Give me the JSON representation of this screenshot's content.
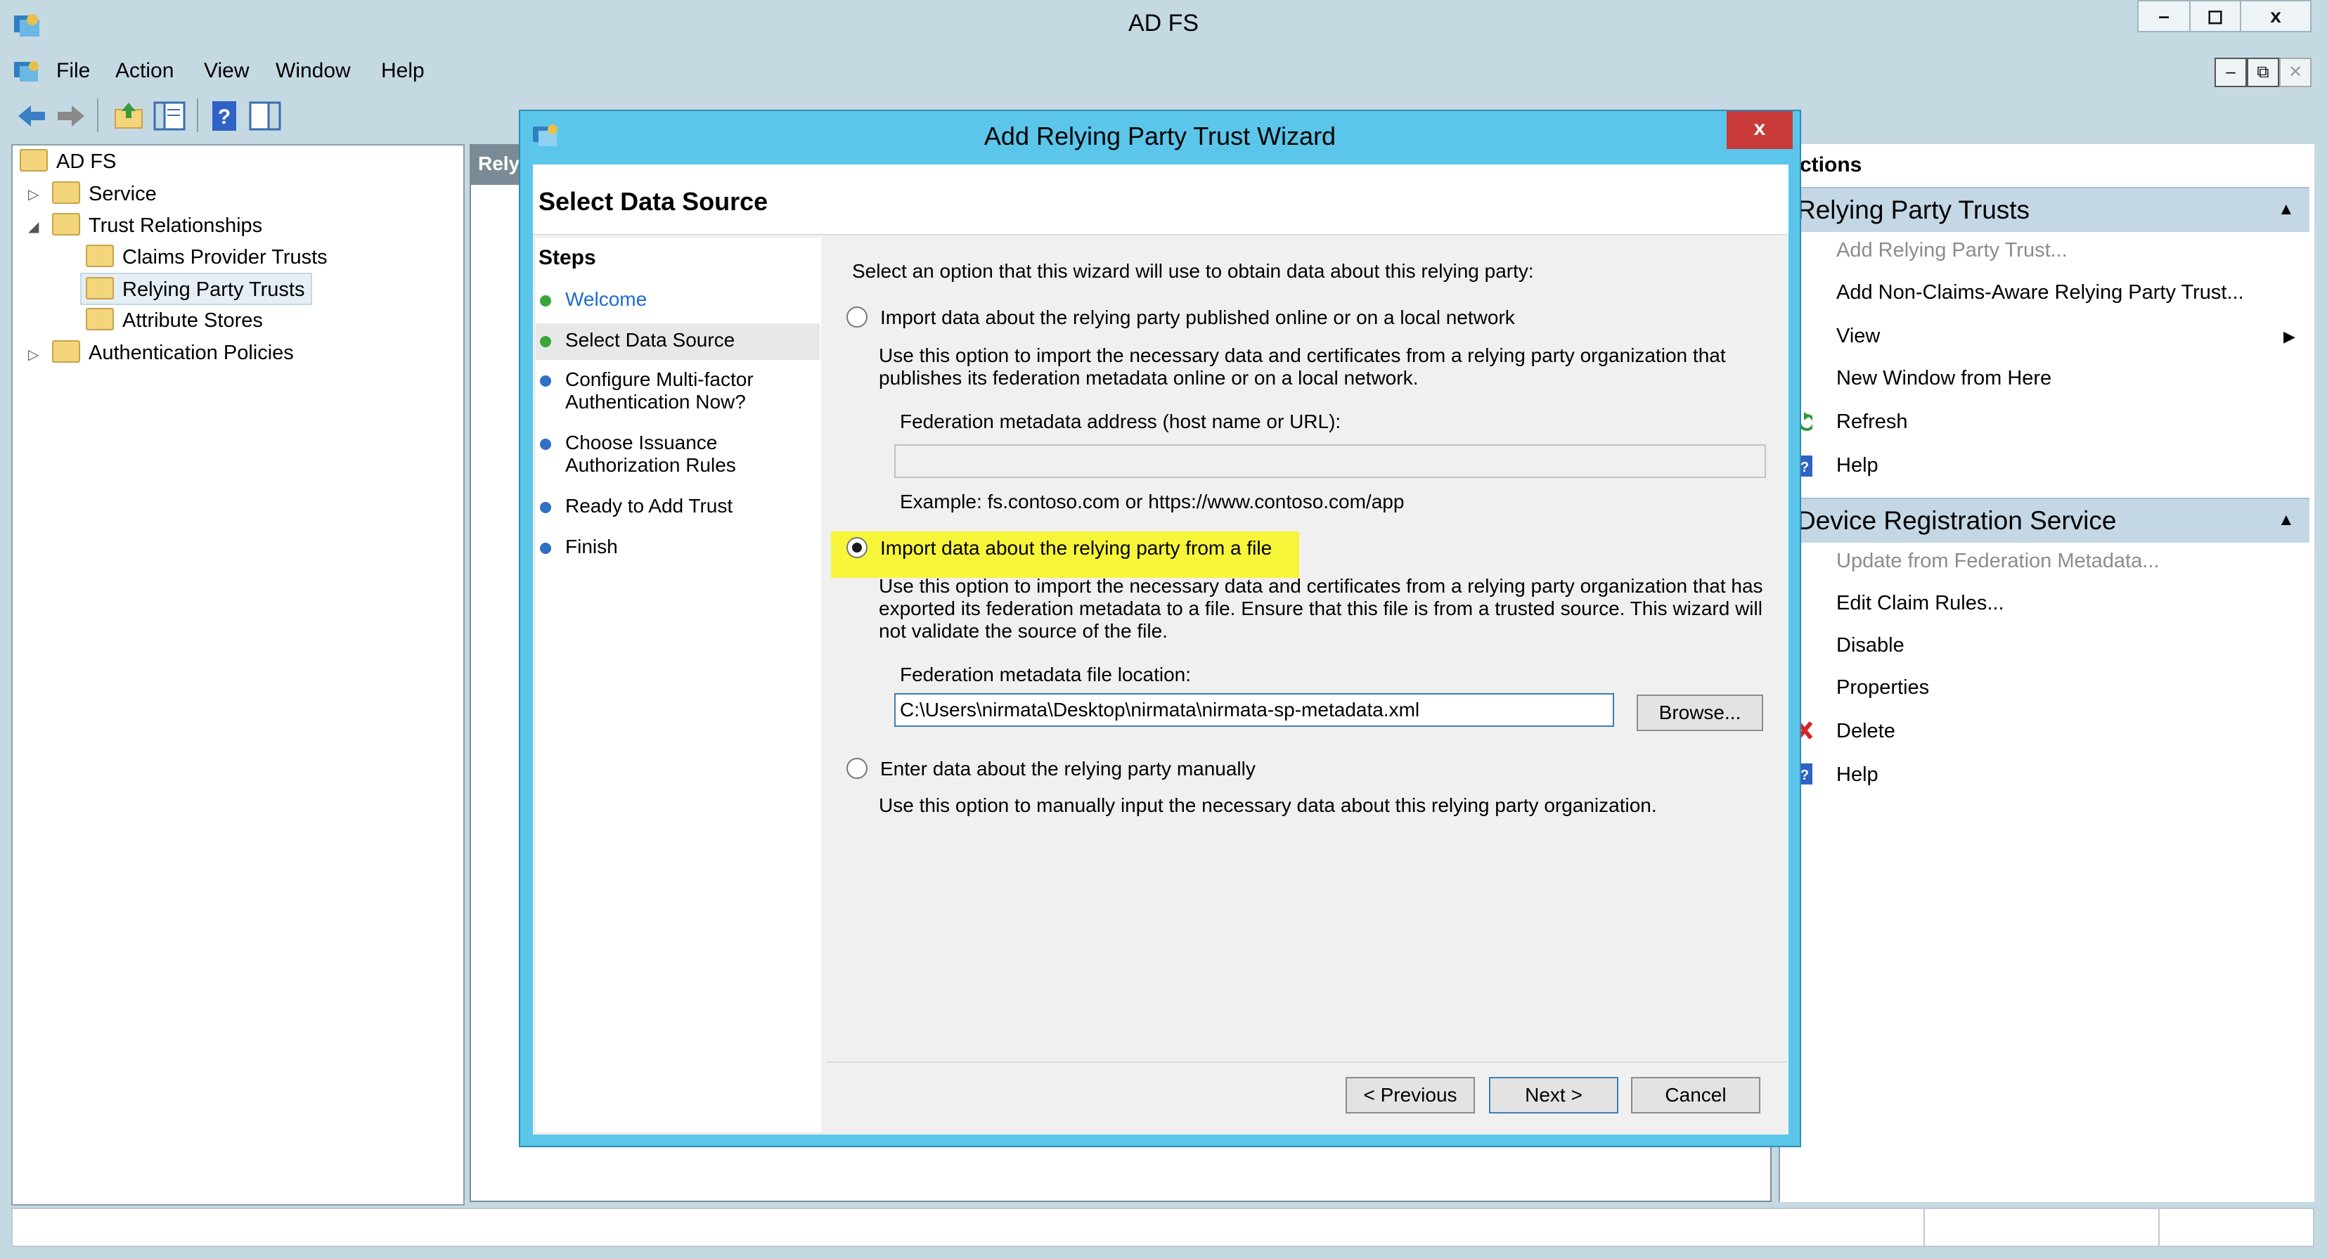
{
  "window": {
    "title": "AD FS",
    "min": "–",
    "max": "◻",
    "close": "x"
  },
  "menu": [
    "File",
    "Action",
    "View",
    "Window",
    "Help"
  ],
  "mdi": {
    "min": "–",
    "restore": "⧉",
    "close": "✕"
  },
  "tree": {
    "root": "AD FS",
    "service": "Service",
    "trust_relationships": "Trust Relationships",
    "claims_provider_trusts": "Claims Provider Trusts",
    "relying_party_trusts": "Relying Party Trusts",
    "attribute_stores": "Attribute Stores",
    "authentication_policies": "Authentication Policies"
  },
  "center_header": "Rely",
  "actions": {
    "title": "ctions",
    "section1": {
      "title": "Relying Party Trusts",
      "items": [
        "Add Relying Party Trust...",
        "Add Non-Claims-Aware Relying Party Trust...",
        "View",
        "New Window from Here",
        "Refresh",
        "Help"
      ]
    },
    "section2": {
      "title": "Device Registration Service",
      "items": [
        "Update from Federation Metadata...",
        "Edit Claim Rules...",
        "Disable",
        "Properties",
        "Delete",
        "Help"
      ]
    }
  },
  "dialog": {
    "title": "Add Relying Party Trust Wizard",
    "close": "x",
    "header": "Select Data Source",
    "steps_title": "Steps",
    "steps": [
      {
        "label": "Welcome",
        "state": "done"
      },
      {
        "label": "Select Data Source",
        "state": "current"
      },
      {
        "label": "Configure Multi-factor Authentication Now?",
        "state": "pending"
      },
      {
        "label": "Choose Issuance Authorization Rules",
        "state": "pending"
      },
      {
        "label": "Ready to Add Trust",
        "state": "pending"
      },
      {
        "label": "Finish",
        "state": "pending"
      }
    ],
    "intro": "Select an option that this wizard will use to obtain data about this relying party:",
    "option1": {
      "label": "Import data about the relying party published online or on a local network",
      "desc": "Use this option to import the necessary data and certificates from a relying party organization that publishes its federation metadata online or on a local network.",
      "field_label": "Federation metadata address (host name or URL):",
      "field_value": "",
      "example": "Example: fs.contoso.com or https://www.contoso.com/app"
    },
    "option2": {
      "label": "Import data about the relying party from a file",
      "desc": "Use this option to import the necessary data and certificates from a relying party organization that has exported its federation metadata to a file. Ensure that this file is from a trusted source.  This wizard will not validate the source of the file.",
      "field_label": "Federation metadata file location:",
      "field_value": "C:\\Users\\nirmata\\Desktop\\nirmata\\nirmata-sp-metadata.xml",
      "browse": "Browse..."
    },
    "option3": {
      "label": "Enter data about the relying party manually",
      "desc": "Use this option to manually input the necessary data about this relying party organization."
    },
    "buttons": {
      "previous": "< Previous",
      "next": "Next >",
      "cancel": "Cancel"
    }
  },
  "colors": {
    "accent": "#5bc6ea",
    "highlight": "#f6f53a",
    "step_done": "#3aa63a",
    "step_pending": "#2f6fc4",
    "link": "#1e6bd0"
  }
}
